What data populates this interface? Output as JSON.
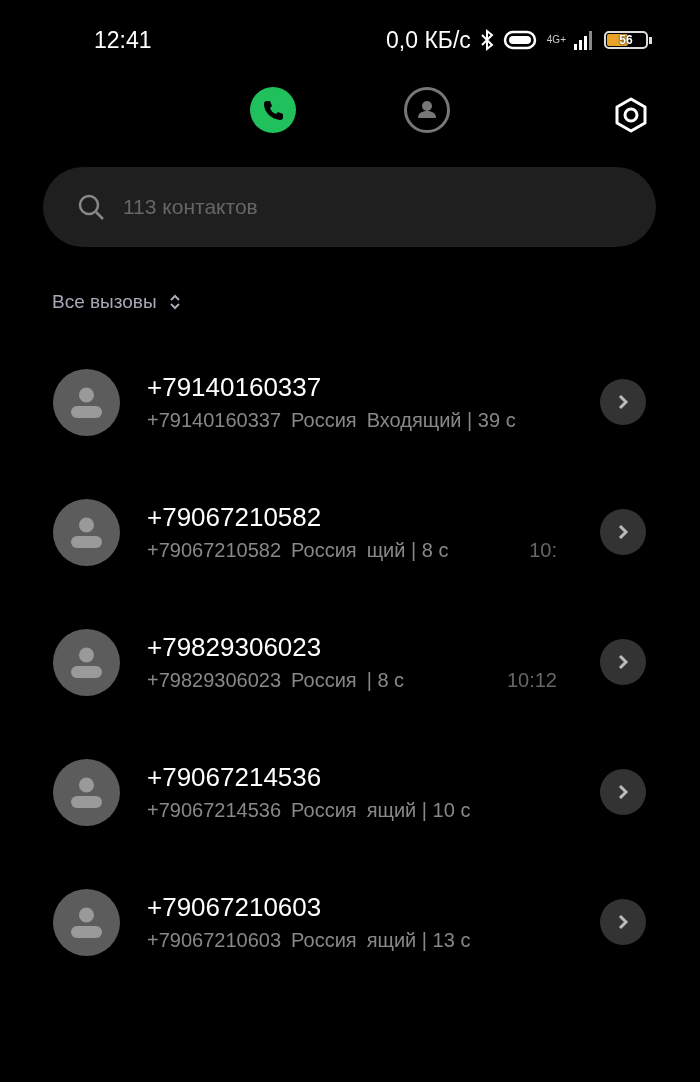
{
  "status_bar": {
    "time": "12:41",
    "speed": "0,0 КБ/с",
    "network": "4G+",
    "battery": "56"
  },
  "tabs": [
    {
      "kind": "phone",
      "selected": true
    },
    {
      "kind": "contacts",
      "selected": false
    }
  ],
  "search": {
    "placeholder": "113 контактов"
  },
  "filter": {
    "label": "Все вызовы"
  },
  "calls": [
    {
      "name": "+79140160337",
      "number": "+79140160337",
      "region": "Россия",
      "detail": "Входящий | 39 с"
    },
    {
      "name": "+79067210582",
      "number": "+79067210582",
      "region": "Россия",
      "detail": "щий | 8 с",
      "time": "10:"
    },
    {
      "name": "+79829306023",
      "number": "+79829306023",
      "region": "Россия",
      "detail": "| 8 с",
      "time": "10:12"
    },
    {
      "name": "+79067214536",
      "number": "+79067214536",
      "region": "Россия",
      "detail": "ящий | 10 с"
    },
    {
      "name": "+79067210603",
      "number": "+79067210603",
      "region": "Россия",
      "detail": "ящий | 13 с"
    }
  ]
}
